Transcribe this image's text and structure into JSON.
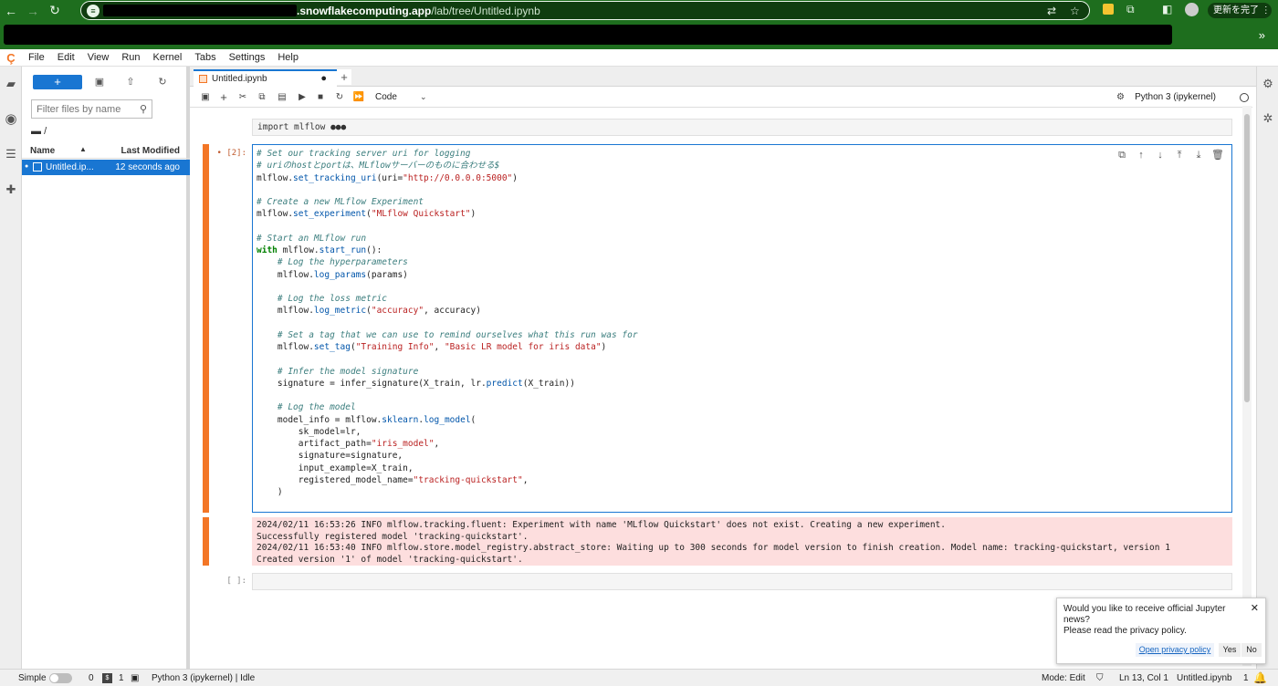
{
  "browser": {
    "url_host": ".snowflakecomputing.app",
    "url_path": "/lab/tree/Untitled.ipynb",
    "update_label": "更新を完了 ⋮",
    "more": "»"
  },
  "menu": [
    "File",
    "Edit",
    "View",
    "Run",
    "Kernel",
    "Tabs",
    "Settings",
    "Help"
  ],
  "filebrowser": {
    "new_label": "+",
    "filter_placeholder": "Filter files by name",
    "breadcrumb": "/",
    "col_name": "Name",
    "col_modified": "Last Modified",
    "files": [
      {
        "name": "Untitled.ip...",
        "modified": "12 seconds ago"
      }
    ]
  },
  "notebook": {
    "tab_title": "Untitled.ipynb",
    "tab_dirty": "●",
    "add_tab": "+",
    "cell_type": "Code",
    "kernel": "Python 3 (ipykernel)",
    "cell1_code": "import mlflow ●●●",
    "cell2_prompt": "• [2]:",
    "cell3_prompt": "[ ]:",
    "output_lines": [
      "2024/02/11 16:53:26 INFO mlflow.tracking.fluent: Experiment with name 'MLflow Quickstart' does not exist. Creating a new experiment.",
      "Successfully registered model 'tracking-quickstart'.",
      "2024/02/11 16:53:40 INFO mlflow.store.model_registry.abstract_store: Waiting up to 300 seconds for model version to finish creation. Model name: tracking-quickstart, version 1",
      "Created version '1' of model 'tracking-quickstart'."
    ]
  },
  "notification": {
    "message_line1": "Would you like to receive official Jupyter news?",
    "message_line2": "Please read the privacy policy.",
    "link": "Open privacy policy",
    "yes": "Yes",
    "no": "No",
    "close": "✕"
  },
  "status": {
    "mode_label": "Simple",
    "terminals": "0",
    "kernels": "1",
    "kernel_state": "Python 3 (ipykernel) | Idle",
    "edit_mode": "Mode: Edit",
    "position": "Ln 13, Col 1",
    "file": "Untitled.ipynb",
    "count": "1"
  },
  "colors": {
    "accent": "#1976d2",
    "jupyter_orange": "#f37626",
    "error_bg": "#fddede",
    "browser_green": "#1e6e1e"
  }
}
